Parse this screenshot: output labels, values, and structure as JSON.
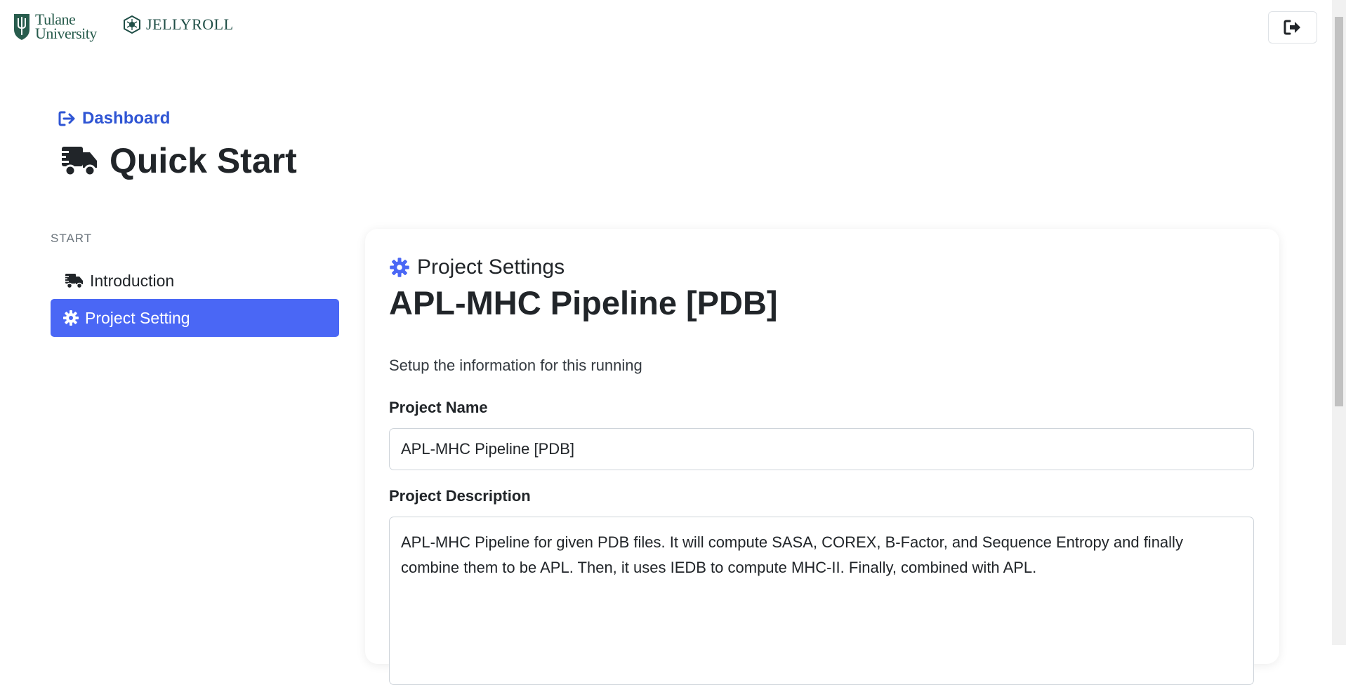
{
  "header": {
    "tulane_logo": {
      "line1": "Tulane",
      "line2": "University"
    },
    "jellyroll_logo": "JELLYROLL",
    "logout_icon": "sign-out-icon"
  },
  "breadcrumb": {
    "label": "Dashboard",
    "icon": "sign-out-icon"
  },
  "page": {
    "title": "Quick Start",
    "icon": "truck-fast-icon"
  },
  "sidebar": {
    "section": "START",
    "items": [
      {
        "label": "Introduction",
        "icon": "truck-fast-icon",
        "active": false
      },
      {
        "label": "Project Setting",
        "icon": "gear-icon",
        "active": true
      }
    ]
  },
  "card": {
    "subtitle": "Project Settings",
    "title": "APL-MHC Pipeline [PDB]",
    "description": "Setup the information for this running",
    "fields": {
      "name_label": "Project Name",
      "name_value": "APL-MHC Pipeline [PDB]",
      "description_label": "Project Description",
      "description_value": "APL-MHC Pipeline for given PDB files. It will compute SASA, COREX, B-Factor, and Sequence Entropy and finally combine them to be APL. Then, it uses IEDB to compute MHC-II. Finally, combined with APL."
    }
  },
  "colors": {
    "accent": "#4a67f5",
    "link": "#2f55d4",
    "brand_green": "#285c4d"
  }
}
